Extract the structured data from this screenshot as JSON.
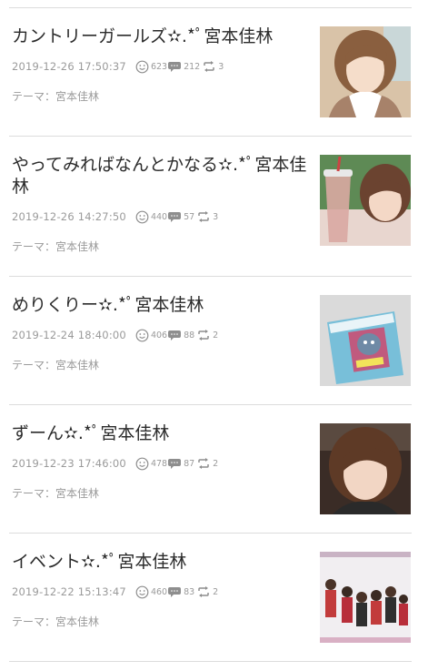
{
  "entries": [
    {
      "title": "カントリーガールズ✫.*ﾟ宮本佳林",
      "date": "2019-12-26 17:50:37",
      "likes": "623",
      "comments": "212",
      "reblogs": "3",
      "theme_label": "テーマ：",
      "theme": "宮本佳林",
      "thumb_icon": "photo-portrait-thumbnail"
    },
    {
      "title": "やってみればなんとかなる✫.*ﾟ宮本佳林",
      "date": "2019-12-26 14:27:50",
      "likes": "440",
      "comments": "57",
      "reblogs": "3",
      "theme_label": "テーマ：",
      "theme": "宮本佳林",
      "thumb_icon": "photo-selfie-drink-thumbnail"
    },
    {
      "title": "めりくりー✫.*ﾟ宮本佳林",
      "date": "2019-12-24 18:40:00",
      "likes": "406",
      "comments": "88",
      "reblogs": "2",
      "theme_label": "テーマ：",
      "theme": "宮本佳林",
      "thumb_icon": "photo-snack-package-thumbnail"
    },
    {
      "title": "ずーん✫.*ﾟ宮本佳林",
      "date": "2019-12-23 17:46:00",
      "likes": "478",
      "comments": "87",
      "reblogs": "2",
      "theme_label": "テーマ：",
      "theme": "宮本佳林",
      "thumb_icon": "photo-selfie-thumbnail"
    },
    {
      "title": "イベント✫.*ﾟ宮本佳林",
      "date": "2019-12-22 15:13:47",
      "likes": "460",
      "comments": "83",
      "reblogs": "2",
      "theme_label": "テーマ：",
      "theme": "宮本佳林",
      "thumb_icon": "photo-group-event-thumbnail"
    }
  ],
  "colors": {
    "separator": "#dcdcdc",
    "title_text": "#2b2b2b",
    "meta_text": "#9a9a9a"
  }
}
